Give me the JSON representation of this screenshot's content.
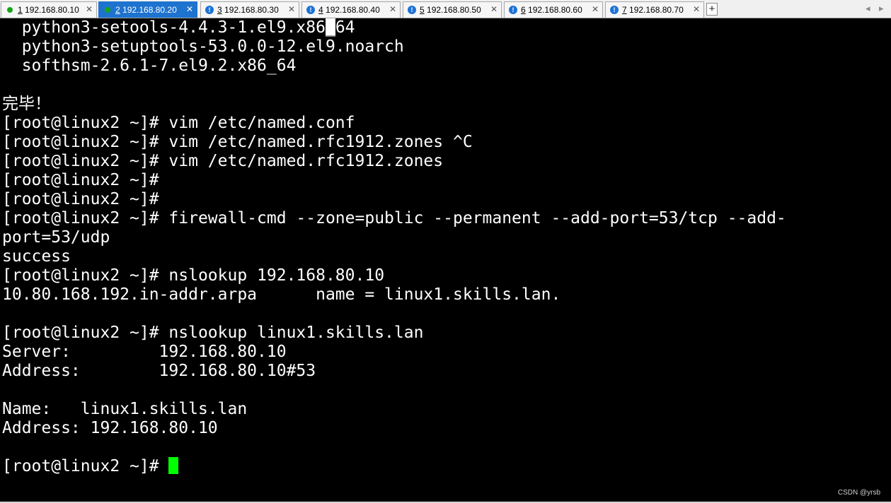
{
  "tabs": [
    {
      "num": "1",
      "title": "192.168.80.10",
      "status": "ok",
      "active": false
    },
    {
      "num": "2",
      "title": "192.168.80.20",
      "status": "ok",
      "active": true
    },
    {
      "num": "3",
      "title": "192.168.80.30",
      "status": "warn",
      "active": false
    },
    {
      "num": "4",
      "title": "192.168.80.40",
      "status": "warn",
      "active": false
    },
    {
      "num": "5",
      "title": "192.168.80.50",
      "status": "warn",
      "active": false
    },
    {
      "num": "6",
      "title": "192.168.80.60",
      "status": "warn",
      "active": false
    },
    {
      "num": "7",
      "title": "192.168.80.70",
      "status": "warn",
      "active": false
    }
  ],
  "tabbar": {
    "new_tab": "+",
    "prev": "◂",
    "next": "▸"
  },
  "terminal": {
    "lines": [
      "  python3-setools-4.4.3-1.el9.x86_64",
      "  python3-setuptools-53.0.0-12.el9.noarch",
      "  softhsm-2.6.1-7.el9.2.x86_64",
      "",
      "完毕！",
      "[root@linux2 ~]# vim /etc/named.conf",
      "[root@linux2 ~]# vim /etc/named.rfc1912.zones ^C",
      "[root@linux2 ~]# vim /etc/named.rfc1912.zones",
      "[root@linux2 ~]#",
      "[root@linux2 ~]#",
      "[root@linux2 ~]# firewall-cmd --zone=public --permanent --add-port=53/tcp --add-",
      "port=53/udp",
      "success",
      "[root@linux2 ~]# nslookup 192.168.80.10",
      "10.80.168.192.in-addr.arpa      name = linux1.skills.lan.",
      "",
      "[root@linux2 ~]# nslookup linux1.skills.lan",
      "Server:         192.168.80.10",
      "Address:        192.168.80.10#53",
      "",
      "Name:   linux1.skills.lan",
      "Address: 192.168.80.10",
      "",
      "[root@linux2 ~]# "
    ]
  },
  "watermark": "CSDN @yrsb",
  "colors": {
    "active_tab": "#1e73cf",
    "status_ok": "#16a516",
    "status_warn": "#1d73d6",
    "cursor": "#00ff00"
  }
}
